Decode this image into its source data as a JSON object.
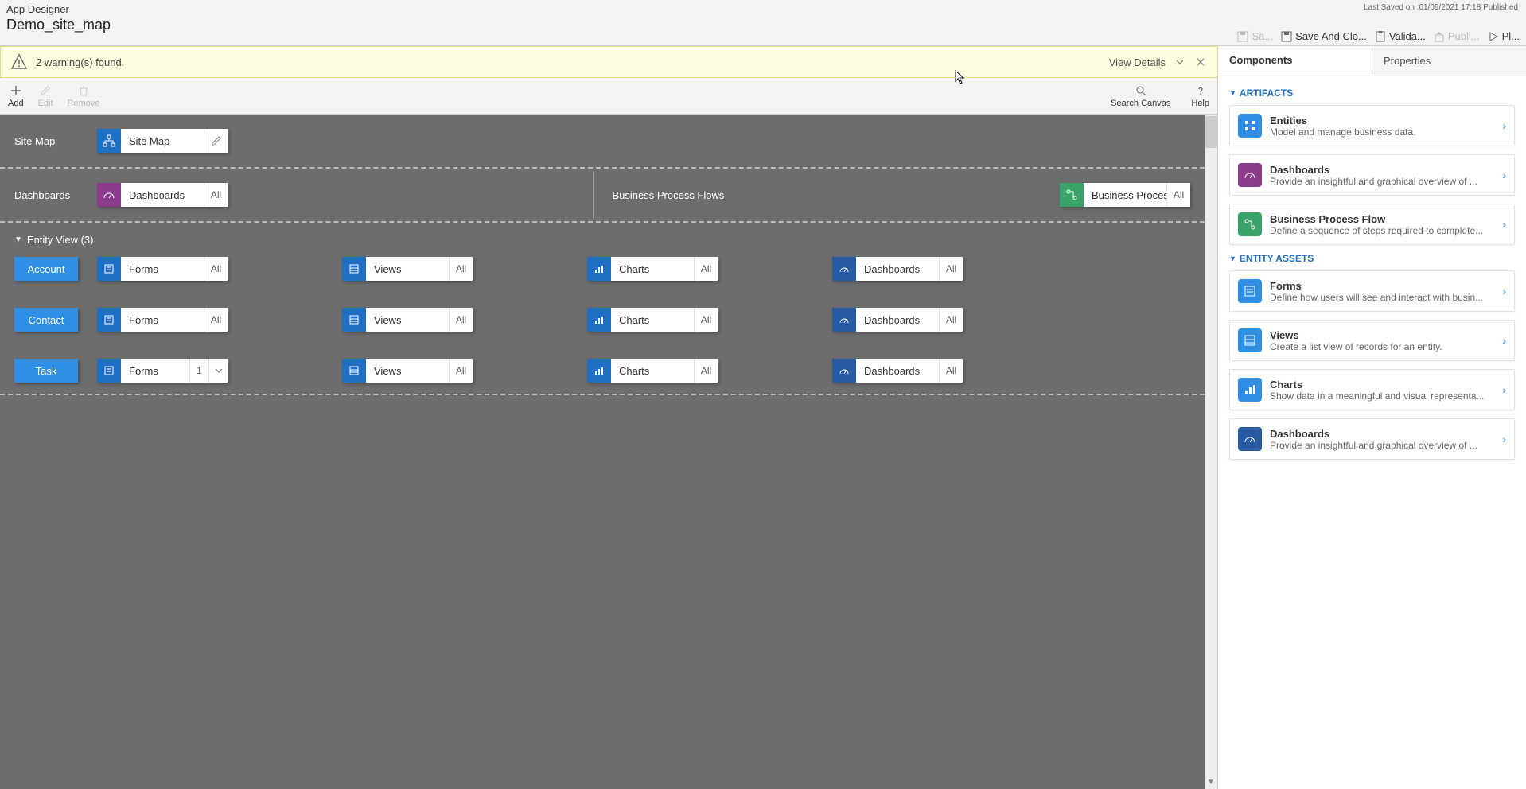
{
  "header": {
    "app_title": "App Designer",
    "app_name": "Demo_site_map",
    "last_saved": "Last Saved on :01/09/2021 17:18 Published",
    "actions": {
      "save": "Sa...",
      "save_close": "Save And Clo...",
      "validate": "Valida...",
      "publish": "Publi...",
      "play": "Pl..."
    }
  },
  "warning": {
    "text": "2 warning(s) found.",
    "view_details": "View Details"
  },
  "toolbar": {
    "add": "Add",
    "edit": "Edit",
    "remove": "Remove",
    "search": "Search Canvas",
    "help": "Help"
  },
  "canvas": {
    "sitemap_label": "Site Map",
    "sitemap_tile": "Site Map",
    "dashboards_label": "Dashboards",
    "dashboards_tile": "Dashboards",
    "bpf_label": "Business Process Flows",
    "bpf_tile": "Business Proces...",
    "all": "All",
    "entity_view_title": "Entity View (3)",
    "entities": [
      "Account",
      "Contact",
      "Task"
    ],
    "cols": {
      "forms": "Forms",
      "views": "Views",
      "charts": "Charts",
      "dashboards": "Dashboards"
    },
    "task_forms_count": "1"
  },
  "panel": {
    "tabs": {
      "components": "Components",
      "properties": "Properties"
    },
    "groups": {
      "artifacts": "ARTIFACTS",
      "entity_assets": "ENTITY ASSETS"
    },
    "cards": {
      "entities": {
        "title": "Entities",
        "desc": "Model and manage business data."
      },
      "dashboards": {
        "title": "Dashboards",
        "desc": "Provide an insightful and graphical overview of ..."
      },
      "bpf": {
        "title": "Business Process Flow",
        "desc": "Define a sequence of steps required to complete..."
      },
      "forms": {
        "title": "Forms",
        "desc": "Define how users will see and interact with busin..."
      },
      "views": {
        "title": "Views",
        "desc": "Create a list view of records for an entity."
      },
      "charts": {
        "title": "Charts",
        "desc": "Show data in a meaningful and visual representa..."
      },
      "dash2": {
        "title": "Dashboards",
        "desc": "Provide an insightful and graphical overview of ..."
      }
    }
  }
}
